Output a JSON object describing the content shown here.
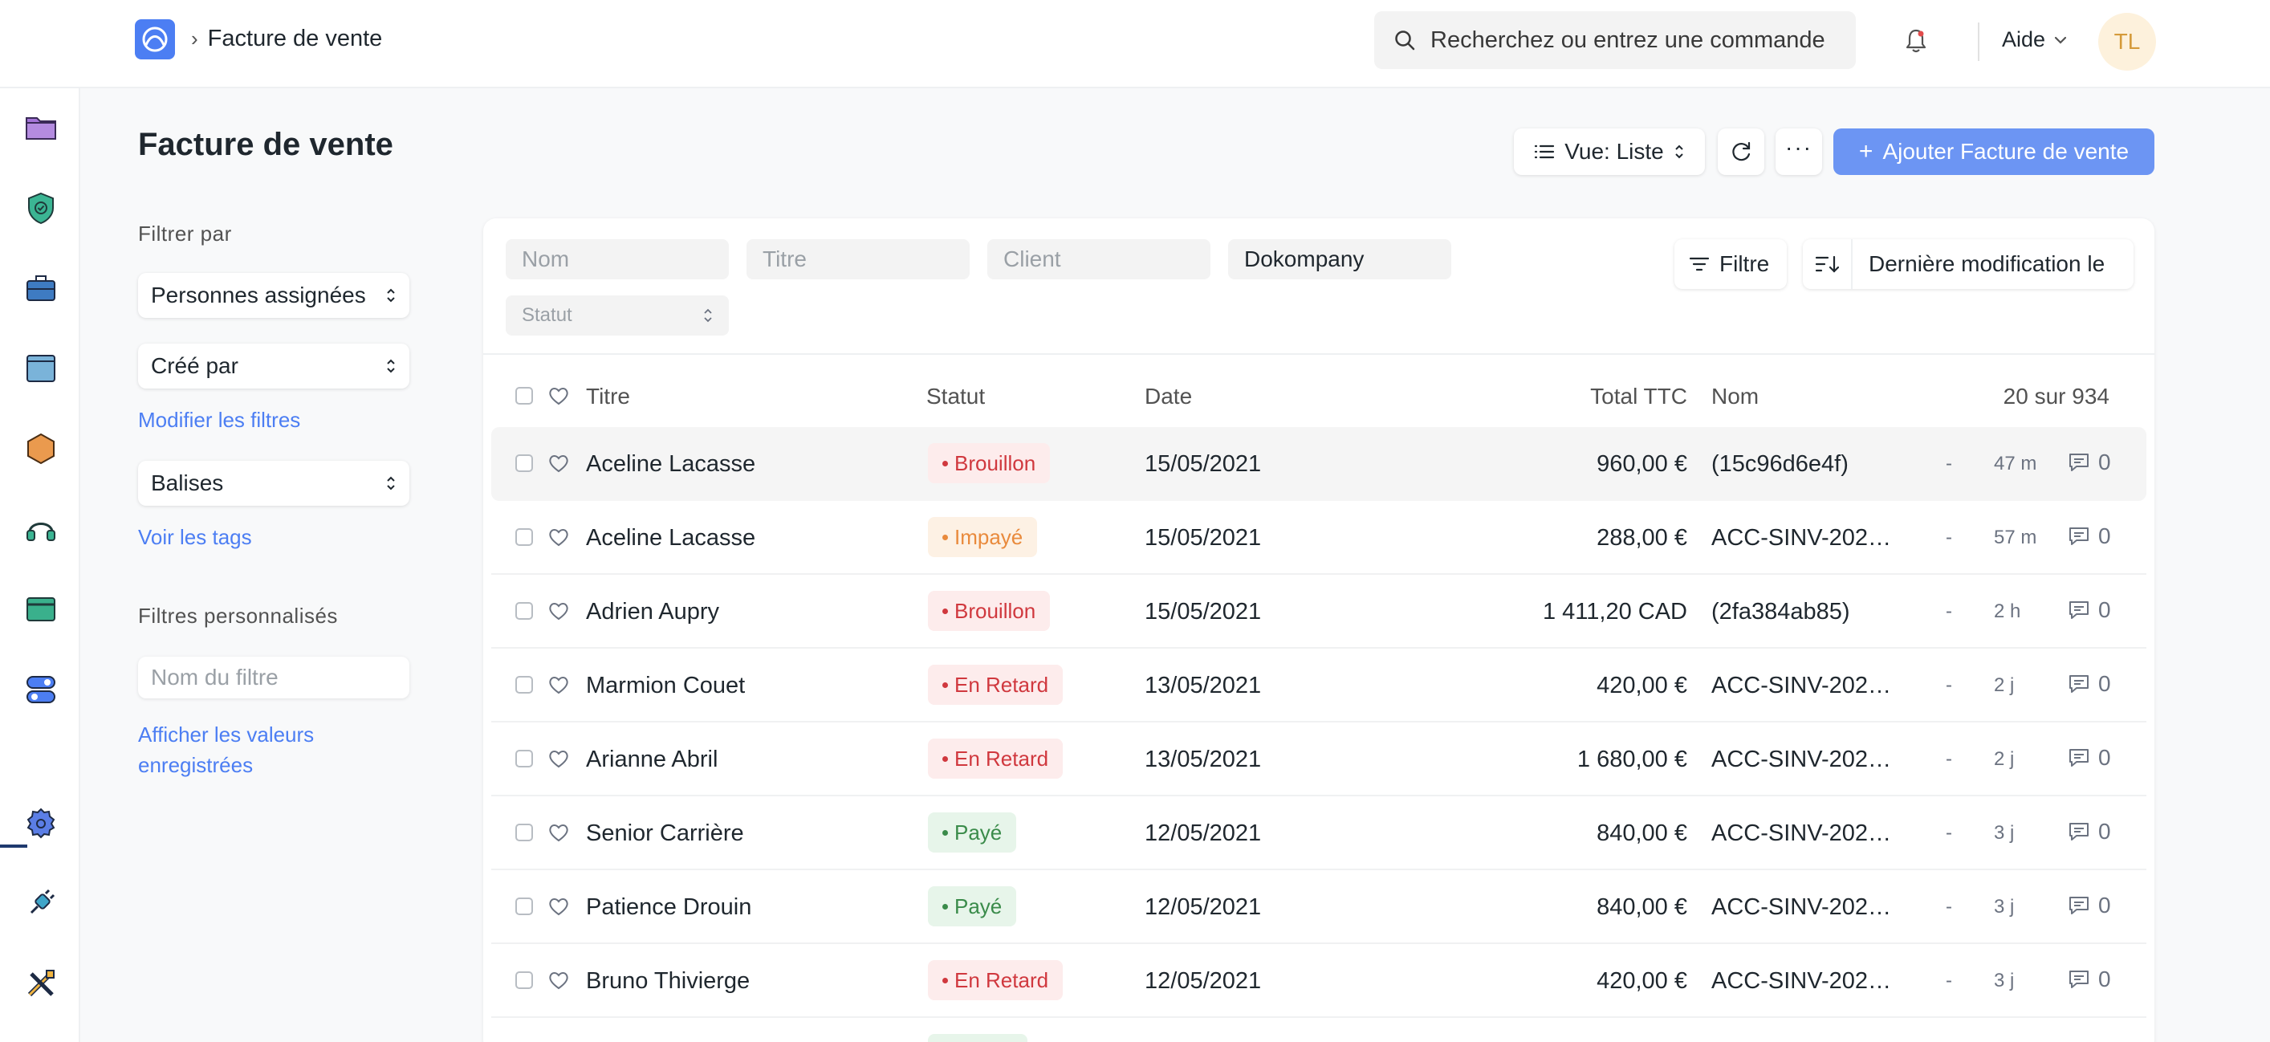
{
  "navbar": {
    "breadcrumb": "Facture de vente",
    "search_placeholder": "Recherchez ou entrez une commande",
    "help_label": "Aide",
    "avatar_initials": "TL"
  },
  "page": {
    "title": "Facture de vente",
    "view_label": "Vue: Liste",
    "add_label": "Ajouter Facture de vente"
  },
  "sidebar": {
    "filter_by": "Filtrer par",
    "assigned": "Personnes assignées",
    "created_by": "Créé par",
    "edit_filters": "Modifier les filtres",
    "tags": "Balises",
    "show_tags": "Voir les tags",
    "custom_filters": "Filtres personnalisés",
    "filter_name_placeholder": "Nom du filtre",
    "show_saved_line1": "Afficher les valeurs",
    "show_saved_line2": "enregistrées"
  },
  "filters": {
    "nom_placeholder": "Nom",
    "titre_placeholder": "Titre",
    "client_placeholder": "Client",
    "company_value": "Dokompany",
    "statut_placeholder": "Statut",
    "filter_label": "Filtre",
    "sort_label": "Dernière modification le"
  },
  "table": {
    "headers": {
      "titre": "Titre",
      "statut": "Statut",
      "date": "Date",
      "total": "Total TTC",
      "nom": "Nom",
      "count": "20 sur 934"
    },
    "rows": [
      {
        "titre": "Aceline Lacasse",
        "statut": "Brouillon",
        "date": "15/05/2021",
        "total": "960,00 €",
        "nom": "(15c96d6e4f)",
        "dash": "-",
        "age": "47 m",
        "comments": "0"
      },
      {
        "titre": "Aceline Lacasse",
        "statut": "Impayé",
        "date": "15/05/2021",
        "total": "288,00 €",
        "nom": "ACC-SINV-202…",
        "dash": "-",
        "age": "57 m",
        "comments": "0"
      },
      {
        "titre": "Adrien Aupry",
        "statut": "Brouillon",
        "date": "15/05/2021",
        "total": "1 411,20 CAD",
        "nom": "(2fa384ab85)",
        "dash": "-",
        "age": "2 h",
        "comments": "0"
      },
      {
        "titre": "Marmion Couet",
        "statut": "En Retard",
        "date": "13/05/2021",
        "total": "420,00 €",
        "nom": "ACC-SINV-202…",
        "dash": "-",
        "age": "2 j",
        "comments": "0"
      },
      {
        "titre": "Arianne Abril",
        "statut": "En Retard",
        "date": "13/05/2021",
        "total": "1 680,00 €",
        "nom": "ACC-SINV-202…",
        "dash": "-",
        "age": "2 j",
        "comments": "0"
      },
      {
        "titre": "Senior Carrière",
        "statut": "Payé",
        "date": "12/05/2021",
        "total": "840,00 €",
        "nom": "ACC-SINV-202…",
        "dash": "-",
        "age": "3 j",
        "comments": "0"
      },
      {
        "titre": "Patience Drouin",
        "statut": "Payé",
        "date": "12/05/2021",
        "total": "840,00 €",
        "nom": "ACC-SINV-202…",
        "dash": "-",
        "age": "3 j",
        "comments": "0"
      },
      {
        "titre": "Bruno Thivierge",
        "statut": "En Retard",
        "date": "12/05/2021",
        "total": "420,00 €",
        "nom": "ACC-SINV-202…",
        "dash": "-",
        "age": "3 j",
        "comments": "0"
      }
    ]
  },
  "status_colors": {
    "Brouillon": {
      "bg": "#fdecec",
      "fg": "#d0383e"
    },
    "En Retard": {
      "bg": "#fdecec",
      "fg": "#d0383e"
    },
    "Impayé": {
      "bg": "#fdf1e4",
      "fg": "#e98a3c"
    },
    "Payé": {
      "bg": "#e7f5ea",
      "fg": "#3a8b4a"
    }
  },
  "accent": "#6c95f3",
  "rail_icons": [
    "folder-icon",
    "shield-check-icon",
    "briefcase-icon",
    "window-icon",
    "hexagon-icon",
    "headset-icon",
    "card-icon",
    "toggle-icon",
    "gear-icon",
    "plug-icon",
    "tools-icon"
  ]
}
